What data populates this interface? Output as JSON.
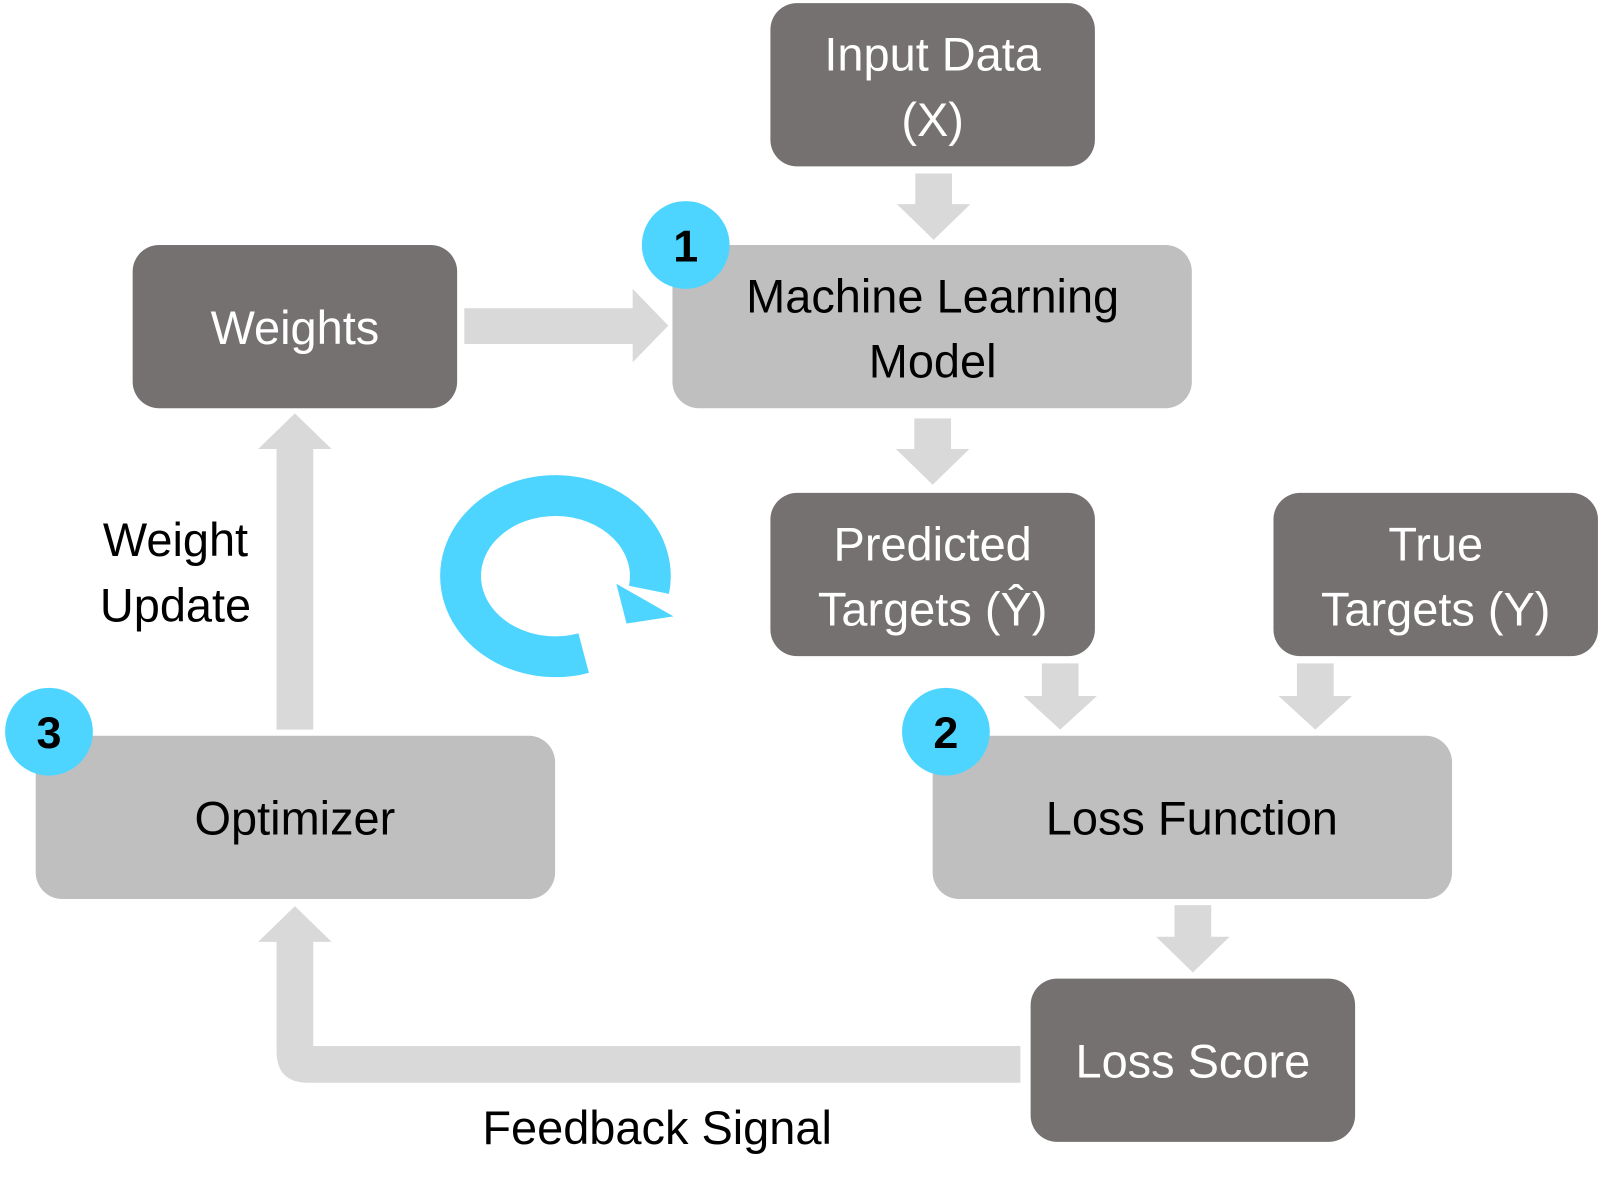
{
  "colors": {
    "dark_box": "#767171",
    "light_box": "#bfbfbf",
    "arrow": "#d9d9d9",
    "accent": "#4dd5ff"
  },
  "nodes": {
    "input": {
      "line1": "Input Data",
      "line2": "(X)"
    },
    "weights": {
      "label": "Weights"
    },
    "model": {
      "line1": "Machine Learning",
      "line2": "Model"
    },
    "predicted": {
      "line1": "Predicted",
      "line2": "Targets (Ŷ)"
    },
    "true": {
      "line1": "True",
      "line2": "Targets (Y)"
    },
    "optimizer": {
      "label": "Optimizer"
    },
    "loss_function": {
      "label": "Loss Function"
    },
    "loss_score": {
      "label": "Loss Score"
    }
  },
  "badges": {
    "model": "1",
    "loss_function": "2",
    "optimizer": "3"
  },
  "labels": {
    "weight_update_1": "Weight",
    "weight_update_2": "Update",
    "feedback": "Feedback Signal"
  },
  "icons": {
    "cycle": "circular-arrow-icon"
  }
}
